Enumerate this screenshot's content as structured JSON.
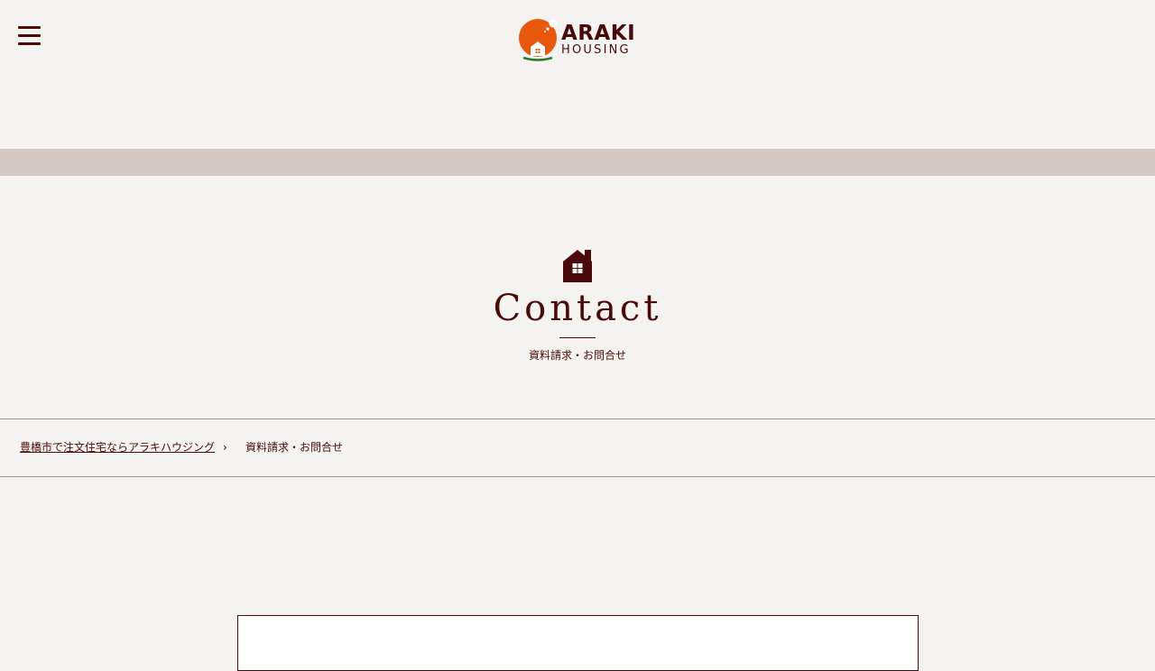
{
  "header": {
    "menu_label": "menu",
    "logo": {
      "word": "ARAKI",
      "sub": "HOUSING",
      "colors": {
        "sun": "#e8580c",
        "ground": "#2f7a2a",
        "text": "#4a0a0a"
      }
    }
  },
  "heading": {
    "icon": "house-icon",
    "title": "Contact",
    "subtitle": "資料請求・お問合せ"
  },
  "breadcrumb": {
    "home_label": "豊橋市で注文住宅ならアラキハウジング",
    "separator": "›",
    "current_label": "資料請求・お問合せ"
  },
  "theme": {
    "background": "#f4f3f1",
    "band": "#d4c8c4",
    "accent": "#4a0a0a"
  }
}
